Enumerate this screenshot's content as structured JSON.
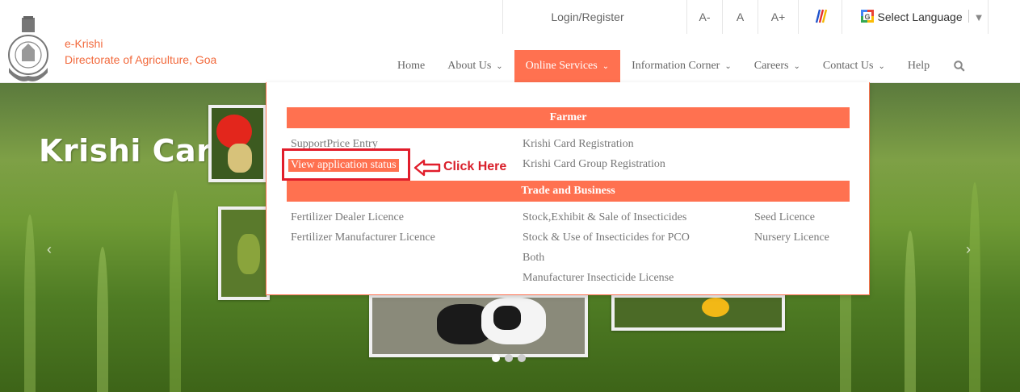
{
  "topbar": {
    "login": "Login/Register",
    "font_small": "A-",
    "font_normal": "A",
    "font_large": "A+",
    "language": "Select Language",
    "language_caret": "▼"
  },
  "brand": {
    "line1": "e-Krishi",
    "line2": "Directorate of Agriculture, Goa"
  },
  "nav": {
    "items": [
      {
        "label": "Home",
        "has_caret": false
      },
      {
        "label": "About Us",
        "has_caret": true
      },
      {
        "label": "Online Services",
        "has_caret": true,
        "active": true
      },
      {
        "label": "Information Corner",
        "has_caret": true
      },
      {
        "label": "Careers",
        "has_caret": true
      },
      {
        "label": "Contact Us",
        "has_caret": true
      },
      {
        "label": "Help",
        "has_caret": false
      }
    ],
    "caret": "⌄"
  },
  "hero": {
    "title": "Krishi Card",
    "prev": "‹",
    "next": "›"
  },
  "dropdown": {
    "farmer_heading": "Farmer",
    "farmer_col1": [
      "SupportPrice Entry",
      "View application status"
    ],
    "farmer_col2": [
      "Krishi Card Registration",
      "Krishi Card Group Registration"
    ],
    "trade_heading": "Trade and Business",
    "trade_col1": [
      "Fertilizer Dealer Licence",
      "Fertilizer Manufacturer Licence"
    ],
    "trade_col2": [
      "Stock,Exhibit & Sale of Insecticides",
      "Stock & Use of Insecticides for PCO",
      "Both",
      "Manufacturer Insecticide License"
    ],
    "trade_col3": [
      "Seed Licence",
      "Nursery Licence"
    ]
  },
  "annotation": {
    "text": "Click Here"
  },
  "colors": {
    "accent": "#ff7150",
    "brand_text": "#f26a3d",
    "annotation_red": "#e11d2b"
  }
}
